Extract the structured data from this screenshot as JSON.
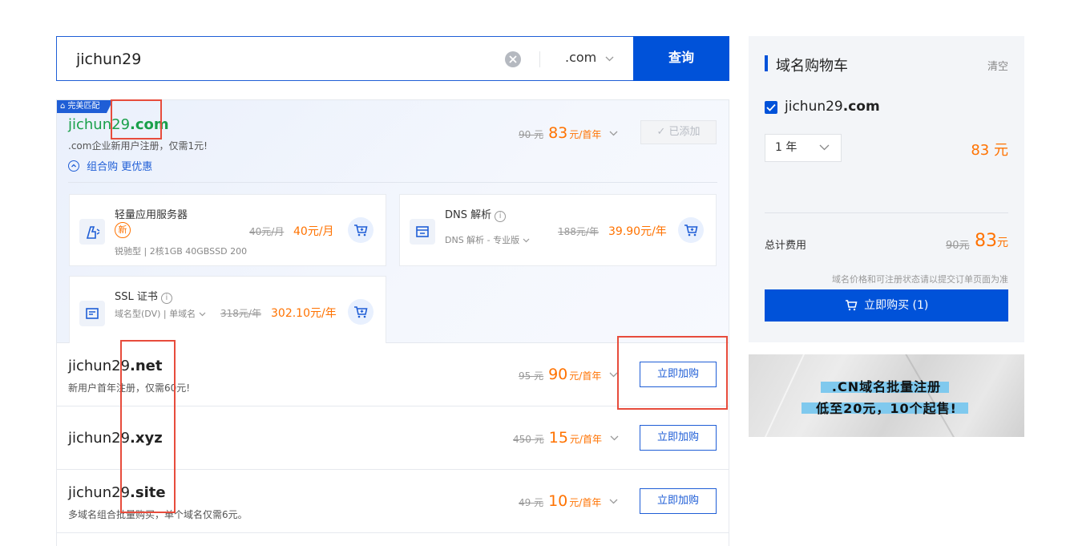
{
  "search": {
    "value": "jichun29",
    "suffix": ".com",
    "button": "查询"
  },
  "match": {
    "badge": "完美匹配",
    "name": "jichun29",
    "tld": ".com",
    "desc": ".com企业新用户注册，仅需1元!",
    "old_price": "90 元",
    "price": "83",
    "unit": "元/首年",
    "added_label": "已添加",
    "combo_link": "组合购 更优惠"
  },
  "products": [
    {
      "name": "轻量应用服务器",
      "tag": "新",
      "spec": "锐驰型 | 2核1GB 40GBSSD 200",
      "old": "40元/月",
      "price": "40元/月",
      "icon": "server-icon"
    },
    {
      "name": "DNS 解析",
      "spec": "DNS 解析 - 专业版",
      "old": "188元/年",
      "price": "39.90元/年",
      "icon": "dns-icon"
    },
    {
      "name": "SSL 证书",
      "spec": "域名型(DV) | 单域名",
      "old": "318元/年",
      "price": "302.10元/年",
      "icon": "certificate-icon"
    }
  ],
  "rows": [
    {
      "name": "jichun29",
      "tld": ".net",
      "desc": "新用户首年注册，仅需60元!",
      "old": "95 元",
      "price": "90",
      "unit": "元/首年",
      "button": "立即加购"
    },
    {
      "name": "jichun29",
      "tld": ".xyz",
      "desc": "",
      "old": "450 元",
      "price": "15",
      "unit": "元/首年",
      "button": "立即加购"
    },
    {
      "name": "jichun29",
      "tld": ".site",
      "desc": "多域名组合批量购买，单个域名仅需6元。",
      "old": "49 元",
      "price": "10",
      "unit": "元/首年",
      "button": "立即加购"
    }
  ],
  "cart": {
    "title": "域名购物车",
    "clear": "清空",
    "domain_name": "jichun29",
    "domain_tld": ".com",
    "year": "1 年",
    "price": "83 元",
    "total_label": "总计费用",
    "total_old": "90元",
    "total_new": "83",
    "total_unit": "元",
    "notice": "域名价格和可注册状态请以提交订单页面为准",
    "buy_button": "立即购买 (1)"
  },
  "banner": {
    "line1": ".CN域名批量注册",
    "line2": "低至20元，10个起售!"
  },
  "colors": {
    "primary": "#0052d9",
    "price": "#ff7200",
    "match_green": "#1aa04a",
    "annotation": "#e74c3c"
  }
}
